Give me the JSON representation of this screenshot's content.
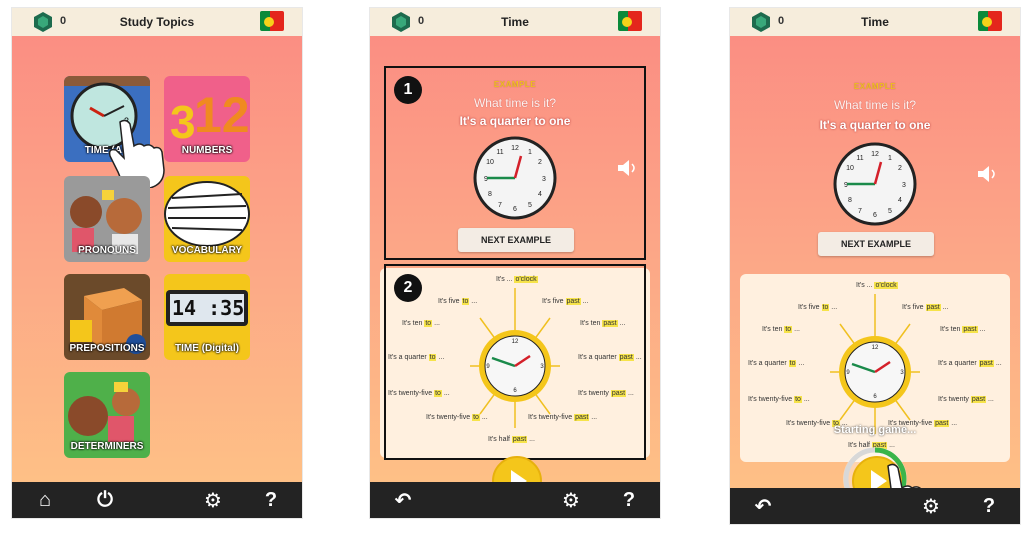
{
  "screens": [
    {
      "title": "Study Topics",
      "gem_count": "0",
      "tiles": [
        {
          "label": "TIME (AN",
          "icon": "analog-clock-icon"
        },
        {
          "label": "NUMBERS",
          "icon": "numbers-icon"
        },
        {
          "label": "PRONOUNS",
          "icon": "pronouns-characters-icon"
        },
        {
          "label": "VOCABULARY",
          "icon": "words-bubble-icon"
        },
        {
          "label": "PREPOSITIONS",
          "icon": "boxes-icon"
        },
        {
          "label": "TIME (Digital)",
          "icon": "digital-clock-icon"
        },
        {
          "label": "DETERMINERS",
          "icon": "determiners-characters-icon"
        }
      ],
      "digital_time": "14 :35",
      "bottom_icons": [
        "home-icon",
        "power-icon",
        "gear-icon",
        "help-icon"
      ]
    },
    {
      "title": "Time",
      "gem_count": "0",
      "badges": [
        "1",
        "2"
      ],
      "example_label": "EXAMPLE",
      "question": "What time is it?",
      "answer": "It's a quarter to one",
      "next_button": "NEXT EXAMPLE",
      "bottom_icons": [
        "back-icon",
        "gear-icon",
        "help-icon"
      ]
    },
    {
      "title": "Time",
      "gem_count": "0",
      "example_label": "EXAMPLE",
      "question": "What time is it?",
      "answer": "It's a quarter to one",
      "next_button": "NEXT EXAMPLE",
      "starting_text": "Starting game...",
      "loading_progress": 0.55,
      "bottom_icons": [
        "back-icon",
        "gear-icon",
        "help-icon"
      ]
    }
  ],
  "guide_labels": {
    "oclock": [
      "It's ... ",
      "o'clock"
    ],
    "five_to": [
      "It's five ",
      "to",
      " ..."
    ],
    "five_past": [
      "It's five ",
      "past",
      " ..."
    ],
    "ten_to": [
      "It's ten ",
      "to",
      " ..."
    ],
    "ten_past": [
      "It's ten ",
      "past",
      " ..."
    ],
    "quarter_to": [
      "It's a quarter ",
      "to",
      " ..."
    ],
    "quarter_past": [
      "It's a quarter ",
      "past",
      " ..."
    ],
    "twentyfive_to_1": [
      "It's twenty-five ",
      "to",
      " ..."
    ],
    "twenty_past": [
      "It's twenty ",
      "past",
      " ..."
    ],
    "twentyfive_to_2": [
      "It's twenty-five ",
      "to",
      " ..."
    ],
    "twentyfive_past": [
      "It's twenty-five ",
      "past",
      " ..."
    ],
    "half_past": [
      "It's half ",
      "past",
      " ..."
    ]
  },
  "colors": {
    "bg_top": "#fb8b82",
    "bg_bottom": "#fec486",
    "bar_dark": "#232323",
    "accent_yellow": "#f4c61b"
  }
}
